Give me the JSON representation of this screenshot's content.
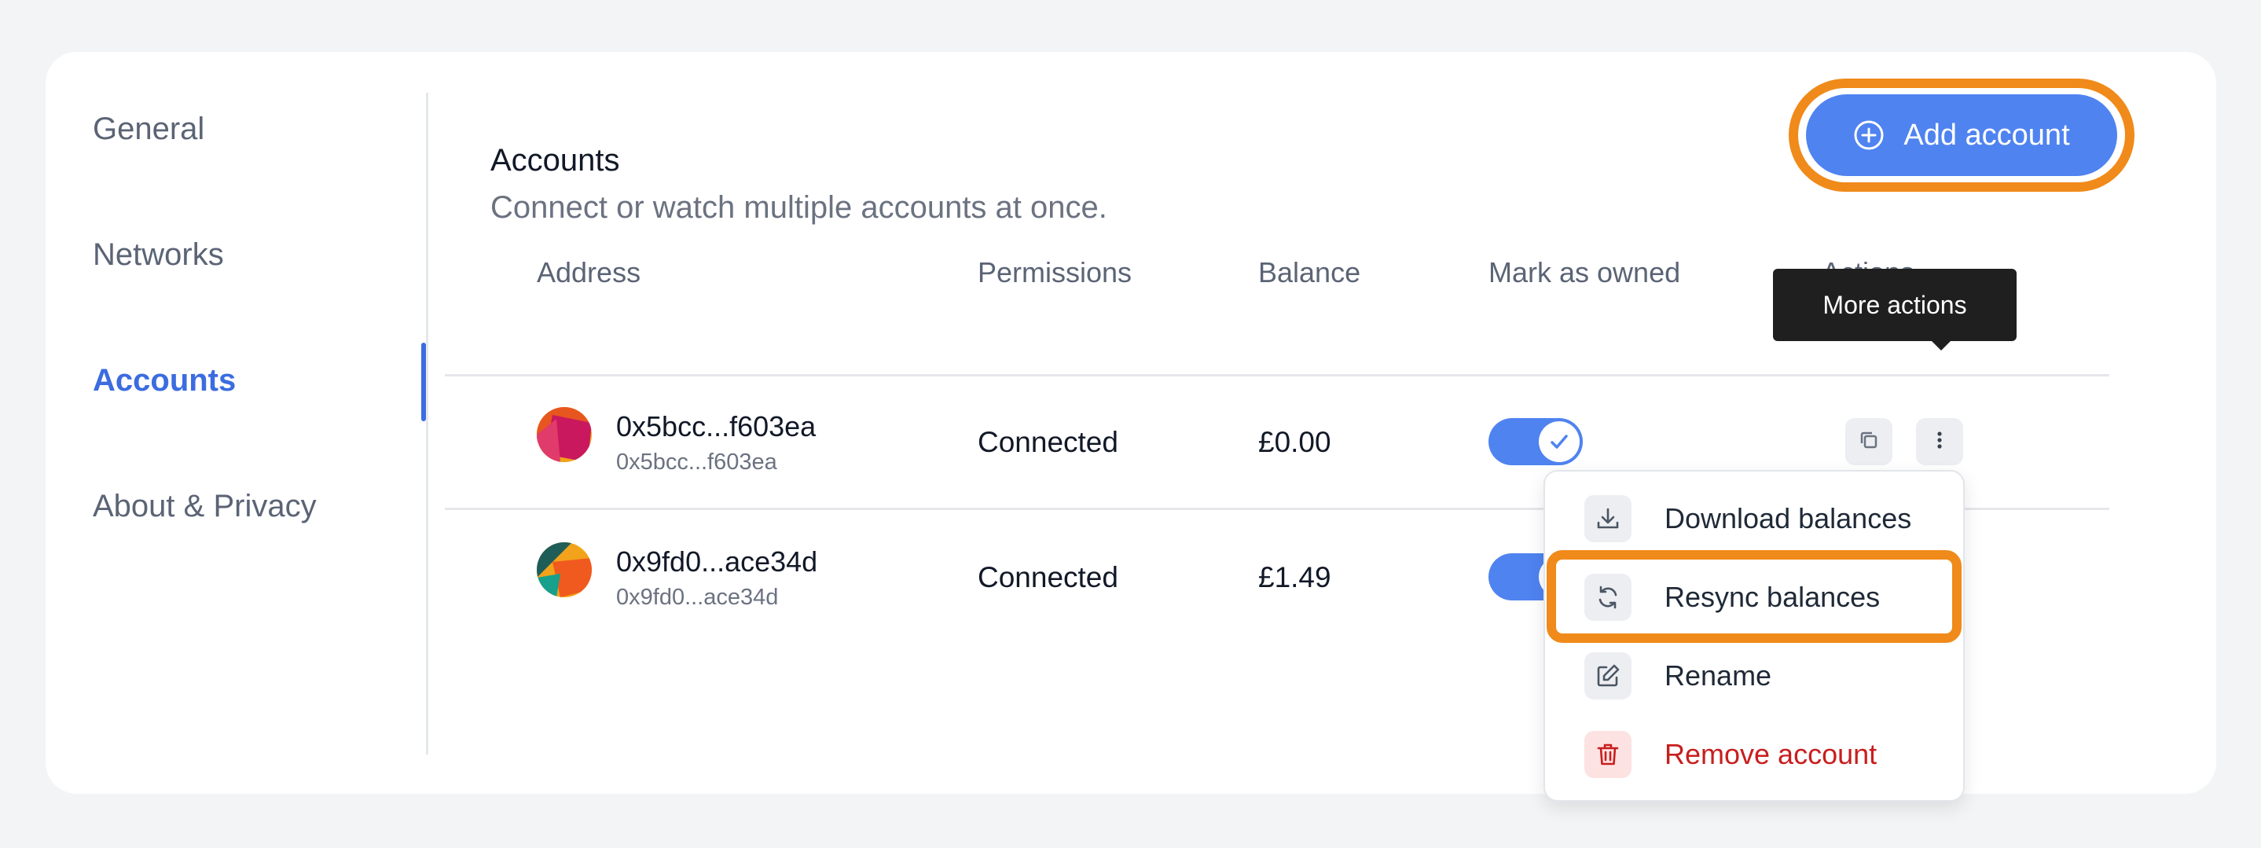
{
  "sidebar": {
    "items": [
      {
        "label": "General",
        "active": false
      },
      {
        "label": "Networks",
        "active": false
      },
      {
        "label": "Accounts",
        "active": true
      },
      {
        "label": "About & Privacy",
        "active": false
      }
    ]
  },
  "header": {
    "title": "Accounts",
    "subtitle": "Connect or watch multiple accounts at once.",
    "add_account_label": "Add account"
  },
  "table": {
    "columns": [
      "Address",
      "Permissions",
      "Balance",
      "Mark as owned",
      "Actions"
    ],
    "rows": [
      {
        "name": "0x5bcc...f603ea",
        "address": "0x5bcc...f603ea",
        "permissions": "Connected",
        "balance": "£0.00",
        "owned": true
      },
      {
        "name": "0x9fd0...ace34d",
        "address": "0x9fd0...ace34d",
        "permissions": "Connected",
        "balance": "£1.49",
        "owned": true
      }
    ]
  },
  "tooltip": {
    "text": "More actions"
  },
  "menu": {
    "items": [
      {
        "label": "Download balances",
        "icon": "download-icon"
      },
      {
        "label": "Resync balances",
        "icon": "refresh-icon"
      },
      {
        "label": "Rename",
        "icon": "edit-icon"
      },
      {
        "label": "Remove account",
        "icon": "trash-icon"
      }
    ]
  },
  "colors": {
    "accent": "#3b6ce0",
    "button": "#4f83f0",
    "highlight": "#f08a1a",
    "danger": "#c81e1e"
  }
}
